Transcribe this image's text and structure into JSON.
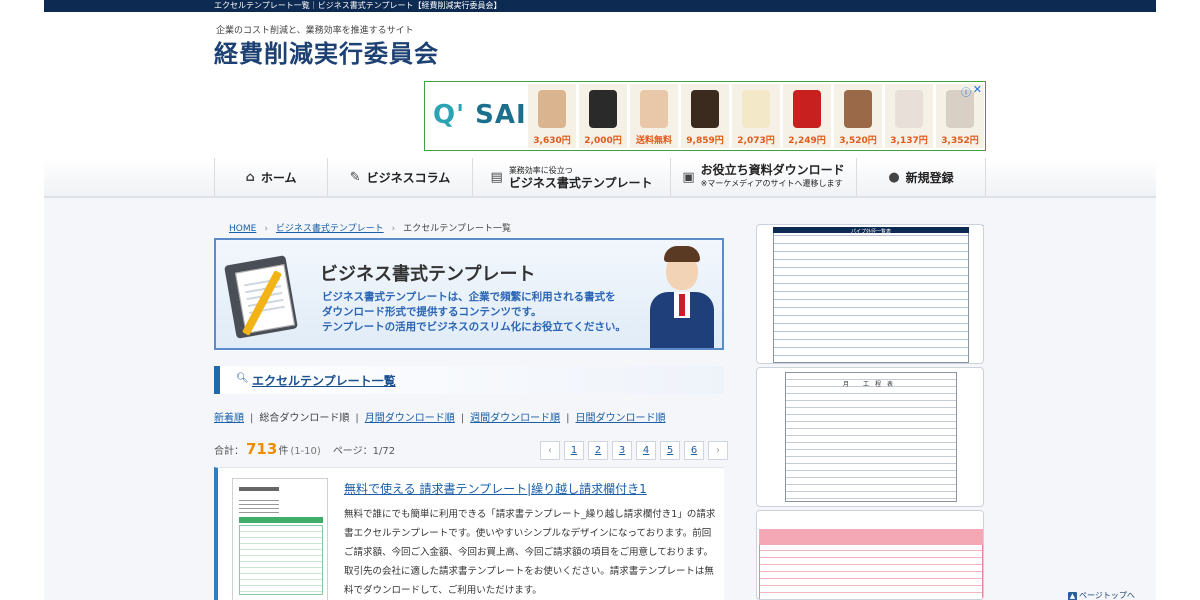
{
  "topbar": {
    "text": "エクセルテンプレート一覧｜ビジネス書式テンプレート【経費削減実行委員会】"
  },
  "site": {
    "tagline": "企業のコスト削減と、業務効率を推進するサイト",
    "logo": "経費削減実行委員会"
  },
  "ad_banner": {
    "brand": "SAI",
    "brand_prefix": "Q'",
    "info_icon": "info-icon",
    "close_icon": "close-icon",
    "products": [
      {
        "price": "3,630円",
        "color": "#d9b48f"
      },
      {
        "price": "2,000円",
        "color": "#2a2a2a"
      },
      {
        "price": "送料無料",
        "color": "#e8c8a8"
      },
      {
        "price": "9,859円",
        "color": "#3b2a1e"
      },
      {
        "price": "2,073円",
        "color": "#f3e8c8"
      },
      {
        "price": "2,249円",
        "color": "#c8201e"
      },
      {
        "price": "3,520円",
        "color": "#9a6a48"
      },
      {
        "price": "3,137円",
        "color": "#e8e0d8"
      },
      {
        "price": "3,352円",
        "color": "#d8d0c4"
      }
    ]
  },
  "nav": {
    "home": "ホーム",
    "column": "ビジネスコラム",
    "template_small": "業務効率に役立つ",
    "template": "ビジネス書式テンプレート",
    "download": "お役立ち資料ダウンロード",
    "download_small": "※マーケメディアのサイトへ遷移します",
    "register": "新規登録"
  },
  "breadcrumb": {
    "home": "HOME",
    "parent": "ビジネス書式テンプレート",
    "current": "エクセルテンプレート一覧"
  },
  "hero": {
    "title": "ビジネス書式テンプレート",
    "line1": "ビジネス書式テンプレートは、企業で頻繁に利用される書式を",
    "line2": "ダウンロード形式で提供するコンテンツです。",
    "line3": "テンプレートの活用でビジネスのスリム化にお役立てください。"
  },
  "section": {
    "title": "エクセルテンプレート一覧"
  },
  "sort": {
    "new": "新着順",
    "total": "総合ダウンロード順",
    "monthly": "月間ダウンロード順",
    "weekly": "週間ダウンロード順",
    "daily": "日間ダウンロード順",
    "separator": "|"
  },
  "summary": {
    "label": "合計：",
    "total": "713",
    "unit": "件",
    "range": "(1-10)",
    "page": "ページ：1/72"
  },
  "pager": {
    "prev": "‹",
    "next": "›",
    "pages": [
      "1",
      "2",
      "3",
      "4",
      "5",
      "6"
    ]
  },
  "card": {
    "title": "無料で使える 請求書テンプレート|繰り越し請求欄付き1",
    "description": "無料で誰にでも簡単に利用できる「請求書テンプレート_繰り越し請求欄付き1」の請求書エクセルテンプレートです。使いやすいシンプルなデザインになっております。前回ご請求額、今回ご入金額、今回お買上高、今回ご請求額の項目をご用意しております。取引先の会社に適した請求書テンプレートをお使いください。請求書テンプレートは無料でダウンロードして、ご利用いただけます。"
  },
  "sidebar": {
    "card1_title": "パイプ外径一覧表",
    "card2_title": "月 工程表"
  },
  "page_top": {
    "label": "ページトップへ"
  }
}
